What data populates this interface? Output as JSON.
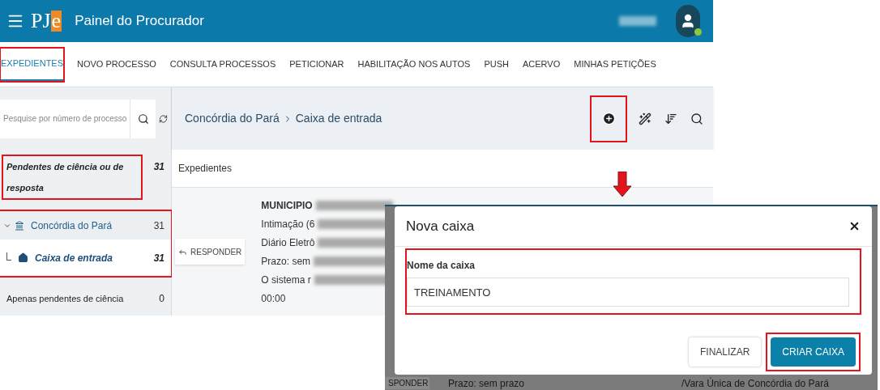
{
  "header": {
    "logo": {
      "main": "PJ",
      "accent": "e"
    },
    "title": "Painel do Procurador"
  },
  "nav": {
    "tabs": [
      {
        "label": "EXPEDIENTES",
        "selected": true,
        "highlighted": true
      },
      {
        "label": "NOVO PROCESSO",
        "selected": false,
        "highlighted": false
      },
      {
        "label": "CONSULTA PROCESSOS",
        "selected": false,
        "highlighted": false
      },
      {
        "label": "PETICIONAR",
        "selected": false,
        "highlighted": false
      },
      {
        "label": "HABILITAÇÃO NOS AUTOS",
        "selected": false,
        "highlighted": false
      },
      {
        "label": "PUSH",
        "selected": false,
        "highlighted": false
      },
      {
        "label": "ACERVO",
        "selected": false,
        "highlighted": false
      },
      {
        "label": "MINHAS PETIÇÕES",
        "selected": false,
        "highlighted": false
      }
    ]
  },
  "sidebar": {
    "search": {
      "placeholder": "Pesquise por número de processo"
    },
    "items": [
      {
        "kind": "filter",
        "label": "Pendentes de ciência ou de resposta",
        "count": "31",
        "selected": true,
        "highlighted": true
      },
      {
        "kind": "folder",
        "label": "Concórdia do Pará",
        "count": "31",
        "expanded": true,
        "highlighted": true,
        "children": [
          {
            "label": "Caixa de entrada",
            "count": "31",
            "selected": true
          }
        ]
      },
      {
        "kind": "filter",
        "label": "Apenas pendentes de ciência",
        "count": "0",
        "selected": false,
        "highlighted": false
      }
    ]
  },
  "main": {
    "breadcrumb": [
      "Concórdia do Pará",
      "Caixa de entrada"
    ],
    "add_highlighted": true,
    "section_title": "Expedientes",
    "card": {
      "button": "RESPONDER",
      "lines": [
        {
          "text": "MUNICIPIO",
          "bold": true,
          "redacted": true
        },
        {
          "text": "Intimação (6",
          "bold": false,
          "redacted": true
        },
        {
          "text": "Diário Eletrô",
          "bold": false,
          "redacted": true
        },
        {
          "text": "Prazo: sem",
          "bold": false,
          "redacted": true
        },
        {
          "text": "O sistema r",
          "bold": false,
          "redacted": true
        },
        {
          "text": "00:00",
          "bold": false,
          "redacted": false
        }
      ]
    }
  },
  "dialog": {
    "title": "Nova caixa",
    "field": {
      "label": "Nome da caixa",
      "value": "TREINAMENTO",
      "highlighted": true
    },
    "buttons": [
      {
        "label": "FINALIZAR",
        "kind": "secondary",
        "highlighted": false
      },
      {
        "label": "CRIAR CAIXA",
        "kind": "primary",
        "highlighted": true
      }
    ],
    "background_texts": [
      "SPONDER",
      "Prazo: sem prazo",
      "/Vara Única de Concórdia do Pará"
    ]
  }
}
